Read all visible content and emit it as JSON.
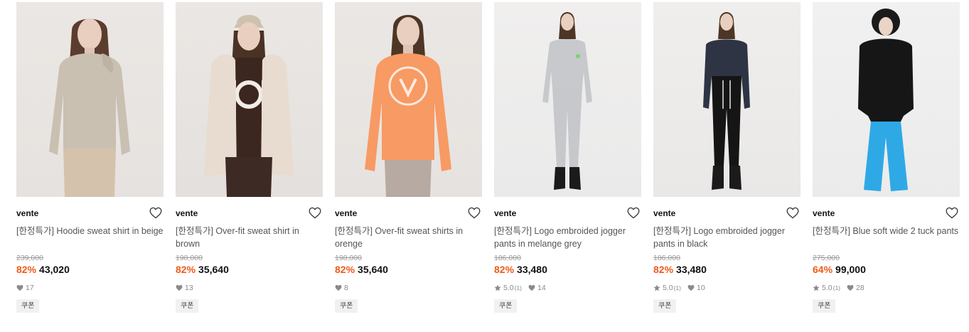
{
  "products": [
    {
      "brand": "vente",
      "name": "[한정특가] Hoodie sweat shirt in beige",
      "original_price": "239,000",
      "discount": "82%",
      "price": "43,020",
      "rating": null,
      "review_count": null,
      "likes": "17",
      "coupon_label": "쿠폰",
      "wish_icon": "heart-outline-icon",
      "colors": {
        "top": "#c9c0b2",
        "bottom": "#d5c2ac",
        "skin": "#e8cfc0",
        "hair": "#5a3d2e"
      }
    },
    {
      "brand": "vente",
      "name": "[한정특가] Over-fit sweat shirt in brown",
      "original_price": "198,000",
      "discount": "82%",
      "price": "35,640",
      "rating": null,
      "review_count": null,
      "likes": "13",
      "coupon_label": "쿠폰",
      "wish_icon": "heart-outline-icon",
      "colors": {
        "top": "#3b2620",
        "coat": "#e7dccf",
        "bottom": "#3e2a25",
        "skin": "#e8cfc0",
        "hair": "#4a3324"
      }
    },
    {
      "brand": "vente",
      "name": "[한정특가] Over-fit sweat shirts in orenge",
      "original_price": "198,000",
      "discount": "82%",
      "price": "35,640",
      "rating": null,
      "review_count": null,
      "likes": "8",
      "coupon_label": "쿠폰",
      "wish_icon": "heart-outline-icon",
      "colors": {
        "top": "#f79a63",
        "bottom": "#b7aaa3",
        "skin": "#e8cfc0",
        "hair": "#4e3626"
      }
    },
    {
      "brand": "vente",
      "name": "[한정특가] Logo embroided jogger pants in melange grey",
      "original_price": "186,000",
      "discount": "82%",
      "price": "33,480",
      "rating": "5.0",
      "review_count": "(1)",
      "likes": "14",
      "coupon_label": "쿠폰",
      "wish_icon": "heart-outline-icon",
      "colors": {
        "top": "#c8c9cc",
        "bottom": "#c7c8cb",
        "skin": "#e8cfc0",
        "hair": "#4e3626",
        "shoe": "#1b1b1b"
      }
    },
    {
      "brand": "vente",
      "name": "[한정특가] Logo embroided jogger pants in black",
      "original_price": "186,000",
      "discount": "82%",
      "price": "33,480",
      "rating": "5.0",
      "review_count": "(1)",
      "likes": "10",
      "coupon_label": "쿠폰",
      "wish_icon": "heart-outline-icon",
      "colors": {
        "top": "#2e3444",
        "bottom": "#151515",
        "skin": "#e8cfc0",
        "hair": "#4e3626",
        "shoe": "#1b1b1b"
      }
    },
    {
      "brand": "vente",
      "name": "[한정특가] Blue soft wide 2 tuck pants",
      "original_price": "275,000",
      "discount": "64%",
      "price": "99,000",
      "rating": "5.0",
      "review_count": "(1)",
      "likes": "28",
      "coupon_label": "쿠폰",
      "wish_icon": "heart-outline-icon",
      "colors": {
        "top": "#161616",
        "bottom": "#2ea9e6",
        "skin": "#ead4c6",
        "hair": "#1a1a1a",
        "shoe": "#2ea9e6"
      }
    }
  ]
}
